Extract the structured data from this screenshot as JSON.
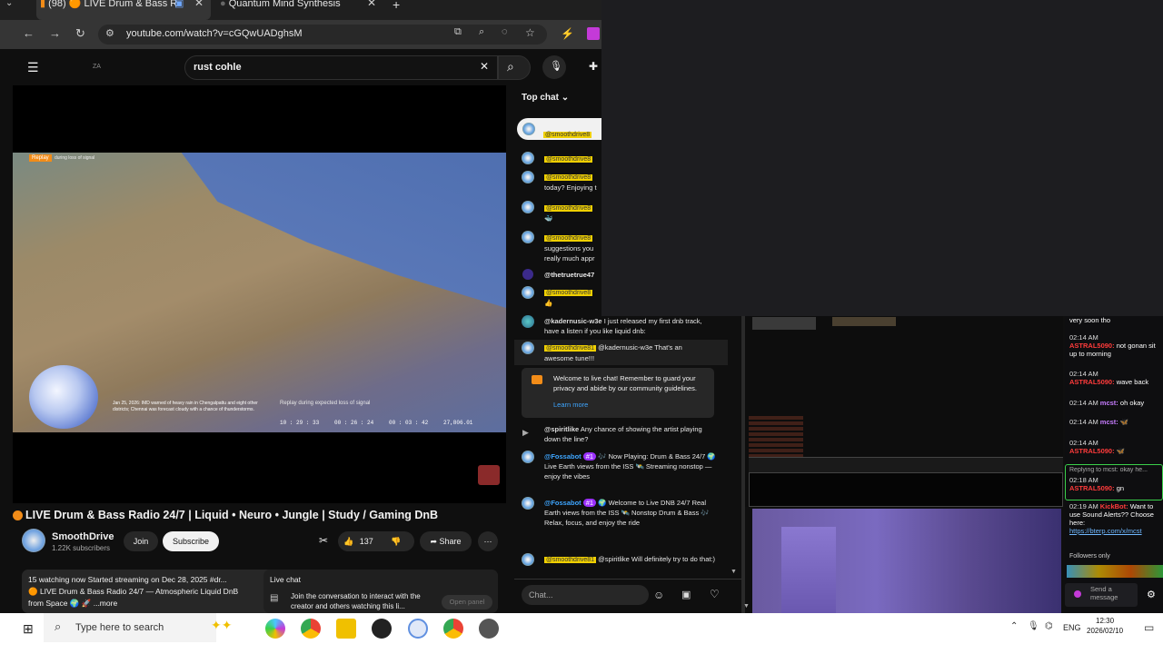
{
  "browser": {
    "tabs": [
      {
        "label": "(98) 🟠 LIVE Drum & Bass R",
        "active": true
      },
      {
        "label": "Quantum Mind Synthesis",
        "active": false
      }
    ],
    "new_tab": "+",
    "url": "youtube.com/watch?v=cGQwUADghsM"
  },
  "youtube": {
    "logo_text": "ZA",
    "search_value": "rust cohle",
    "video": {
      "replay_tag": "Replay",
      "replay_subtitle": "during loss of signal",
      "osd_caption": "Jan 25, 2026: IMD warned of heavy rain in Chengalpattu and eight other districts; Chennai was forecast cloudy with a chance of thunderstorms.",
      "osd_replay": "Replay during expected loss of signal",
      "osd_times": [
        "10 : 29 : 33",
        "00 : 26 : 24",
        "00 : 03 : 42",
        "27,806.01"
      ]
    },
    "title": "LIVE Drum & Bass Radio 24/7 | Liquid • Neuro • Jungle | Study / Gaming DnB",
    "channel": {
      "name": "SmoothDrive",
      "subs": "1.22K subscribers"
    },
    "buttons": {
      "join": "Join",
      "subscribe": "Subscribe",
      "likes": "137",
      "share": "Share"
    },
    "description": {
      "line1": "15 watching now  Started streaming on Dec 28, 2025  #dr...",
      "line2": "🟠 LIVE Drum & Bass Radio 24/7 — Atmospheric Liquid DnB",
      "line3": "from Space 🌍 🚀  ...more"
    },
    "live_chat_box": {
      "title": "Live chat",
      "text": "Join the conversation to interact with the creator and others watching this li...",
      "button": "Open panel"
    }
  },
  "chat": {
    "header": "Top chat",
    "messages": [
      {
        "user": "@smoothdrive8",
        "text": ""
      },
      {
        "user": "@smoothdrive8",
        "text": ""
      },
      {
        "user": "@smoothdrive8",
        "text": "today? Enjoying t"
      },
      {
        "user": "@smoothdrive8",
        "text": "suggestions you really much appr"
      },
      {
        "user": "@thetruetrue47",
        "text": ""
      },
      {
        "user": "@smoothdrive8",
        "text": "👍"
      },
      {
        "user": "@kadernusic-w3e",
        "text": "I just released my first dnb track, have a listen if you like liquid dnb:"
      },
      {
        "user": "@smoothdrive81",
        "text": "@kadernusic-w3e That's an awesome tune!!!"
      }
    ],
    "welcome": {
      "text": "Welcome to live chat! Remember to guard your privacy and abide by our community guidelines.",
      "link": "Learn more"
    },
    "messages2": [
      {
        "user": "@spiritlike",
        "text": "Any chance of showing the artist playing down the line?"
      },
      {
        "user": "@Fossabot",
        "badge": "#1",
        "text": "🎶 Now Playing: Drum & Bass 24/7 🌍 Live Earth views from the ISS 🛰️ Streaming nonstop — enjoy the vibes"
      },
      {
        "user": "@Fossabot",
        "badge": "#1",
        "text": "🌍 Welcome to Live DNB 24/7 Real Earth views from the ISS 🛰️ Nonstop Drum & Bass 🎶 Relax, focus, and enjoy the ride"
      },
      {
        "user": "@smoothdrive81",
        "text": "@spiritlike Will definitely try to do that:)"
      }
    ],
    "input_placeholder": "Chat..."
  },
  "kick_chat": {
    "items": [
      {
        "time": "",
        "user": "",
        "text": "very soon tho"
      },
      {
        "time": "02:14 AM",
        "user": "ASTRAL5090:",
        "text": "not gonan sit up to morning"
      },
      {
        "time": "02:14 AM",
        "user": "ASTRAL5090:",
        "text": "wave back"
      },
      {
        "time": "02:14 AM",
        "user": "mcst:",
        "text": "oh okay"
      },
      {
        "time": "02:14 AM",
        "user": "mcst:",
        "text": "🦋"
      },
      {
        "time": "02:14 AM",
        "user": "ASTRAL5090:",
        "text": "🦋"
      },
      {
        "time": "02:18 AM",
        "user": "ASTRAL5090:",
        "text": "gn"
      },
      {
        "time": "02:19 AM",
        "user": "KickBot:",
        "text": "Want to use Sound Alerts?? Choose here:"
      }
    ],
    "reply_hint": "Replying to mcst: okay he...",
    "link": "https://bterp.com/x/mcst",
    "followers_only": "Followers only",
    "send": "Send a message"
  },
  "taskbar": {
    "search_placeholder": "Type here to search",
    "lang": "ENG",
    "time": "12:30",
    "date": "2026/02/10"
  }
}
